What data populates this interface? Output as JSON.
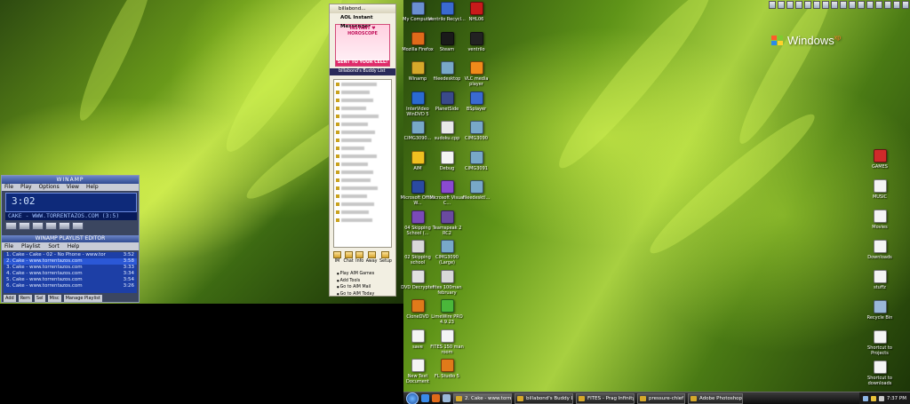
{
  "winamp": {
    "title": "WINAMP",
    "menu": [
      "File",
      "Play",
      "Options",
      "View",
      "Help"
    ],
    "time": "3:02",
    "ticker": "CAKE - WWW.TORRENTAZOS.COM (3:5)",
    "playlist_title": "WINAMP PLAYLIST EDITOR",
    "playlist_menu": [
      "File",
      "Playlist",
      "Sort",
      "Help"
    ],
    "playlist": [
      {
        "title": "1. Cake - Cake - 02 - No Phone - www.tor",
        "time": "3:52"
      },
      {
        "title": "2. Cake - www.torrentazos.com",
        "time": "3:58"
      },
      {
        "title": "3. Cake - www.torrentazos.com",
        "time": "3:33"
      },
      {
        "title": "4. Cake - www.torrentazos.com",
        "time": "3:34"
      },
      {
        "title": "5. Cake - www.torrentazos.com",
        "time": "3:54"
      },
      {
        "title": "6. Cake - www.torrentazos.com",
        "time": "3:26"
      }
    ],
    "bottom_buttons": [
      "Add",
      "Rem",
      "Sel",
      "Misc",
      "Manage Playlist"
    ]
  },
  "aim": {
    "window_title": "billabond...",
    "brand": "AOL Instant Messenger",
    "ad_headline": "INSTANT ♥ HOROSCOPE",
    "ad_sub": "SENT TO YOUR CELL!",
    "buddy_list_title": "billabond's Buddy List",
    "toolbar": [
      "IM",
      "Chat",
      "Info",
      "Away",
      "Setup"
    ],
    "links": [
      "Play AIM Games",
      "Add Tools",
      "Go to AIM Mail",
      "Go to AIM Today"
    ]
  },
  "desktop_icons_col1": [
    {
      "label": "My Computer",
      "color": "#6a8fd0"
    },
    {
      "label": "Mozilla Firefox",
      "color": "#e06a1a"
    },
    {
      "label": "Winamp",
      "color": "#d6a82a"
    },
    {
      "label": "InterVideo WinDVD 5",
      "color": "#2a6ad0"
    },
    {
      "label": "CIMG3090...",
      "color": "#78a8c8"
    },
    {
      "label": "AIM",
      "color": "#f0c020"
    },
    {
      "label": "Microsoft Office W...",
      "color": "#2a4aa0"
    },
    {
      "label": "04 Skipping School (...",
      "color": "#7a4ab8"
    },
    {
      "label": "02 Skipping school",
      "color": "#d8d8d8"
    },
    {
      "label": "DVD Decrypter",
      "color": "#e0e0e0"
    },
    {
      "label": "CloneDVD",
      "color": "#e07a1a"
    },
    {
      "label": "save",
      "color": "#f4f4f4"
    },
    {
      "label": "New Text Document",
      "color": "#f4f4f4"
    }
  ],
  "desktop_icons_col2": [
    {
      "label": "Ventrilo Recycl...",
      "color": "#3a6ad0"
    },
    {
      "label": "Steam",
      "color": "#1a1a1a"
    },
    {
      "label": "fileedesktop",
      "color": "#78a8c8"
    },
    {
      "label": "PlanetSide",
      "color": "#3a4a8a"
    },
    {
      "label": "sudoku.cpp",
      "color": "#e8e8e8"
    },
    {
      "label": "Debug",
      "color": "#f4f4f4"
    },
    {
      "label": "Microsoft Visual C...",
      "color": "#8a4ad0"
    },
    {
      "label": "Teamspeak 2 RC2",
      "color": "#6a4aa0"
    },
    {
      "label": "CIMG3090 (Large)",
      "color": "#78a8c8"
    },
    {
      "label": "fites 100man february",
      "color": "#d8d8d8"
    },
    {
      "label": "LimeWire PRO 4.9.23",
      "color": "#4ab83a"
    },
    {
      "label": "FITES 150 man room",
      "color": "#f4f4f4"
    },
    {
      "label": "FL Studio 5",
      "color": "#e07a1a"
    }
  ],
  "desktop_icons_col3": [
    {
      "label": "NHL06",
      "color": "#c81a1a"
    },
    {
      "label": "ventrilo",
      "color": "#222222"
    },
    {
      "label": "VLC media player",
      "color": "#f08a1a"
    },
    {
      "label": "BSplayer",
      "color": "#3a6ad0"
    },
    {
      "label": "CIMG3090",
      "color": "#78a8c8"
    },
    {
      "label": "CIMG3091",
      "color": "#78a8c8"
    },
    {
      "label": "fileedesktl...",
      "color": "#78a8c8"
    }
  ],
  "desktop_icons_right": [
    {
      "label": "GAMES",
      "color": "#d02a2a"
    },
    {
      "label": "MUSIC",
      "color": "#f4f4f4"
    },
    {
      "label": "Movies",
      "color": "#f4f4f4"
    },
    {
      "label": "Downloads",
      "color": "#f4f4f4"
    },
    {
      "label": "stuffz",
      "color": "#f4f4f4"
    },
    {
      "label": "Recycle Bin",
      "color": "#9ab8d8"
    },
    {
      "label": "Shortcut to Projects",
      "color": "#f4f4f4"
    },
    {
      "label": "Shortcut to downloads",
      "color": "#f4f4f4"
    }
  ],
  "windows_logo": "Windows",
  "windows_logo_sup": "xp",
  "taskbar": {
    "tasks": [
      "2. Cake - www.torre...",
      "billabond's Buddy Lis...",
      "FITES - Prag Infinity ...",
      "pressure-chief",
      "Adobe Photoshop"
    ],
    "clock": "7:37 PM"
  }
}
